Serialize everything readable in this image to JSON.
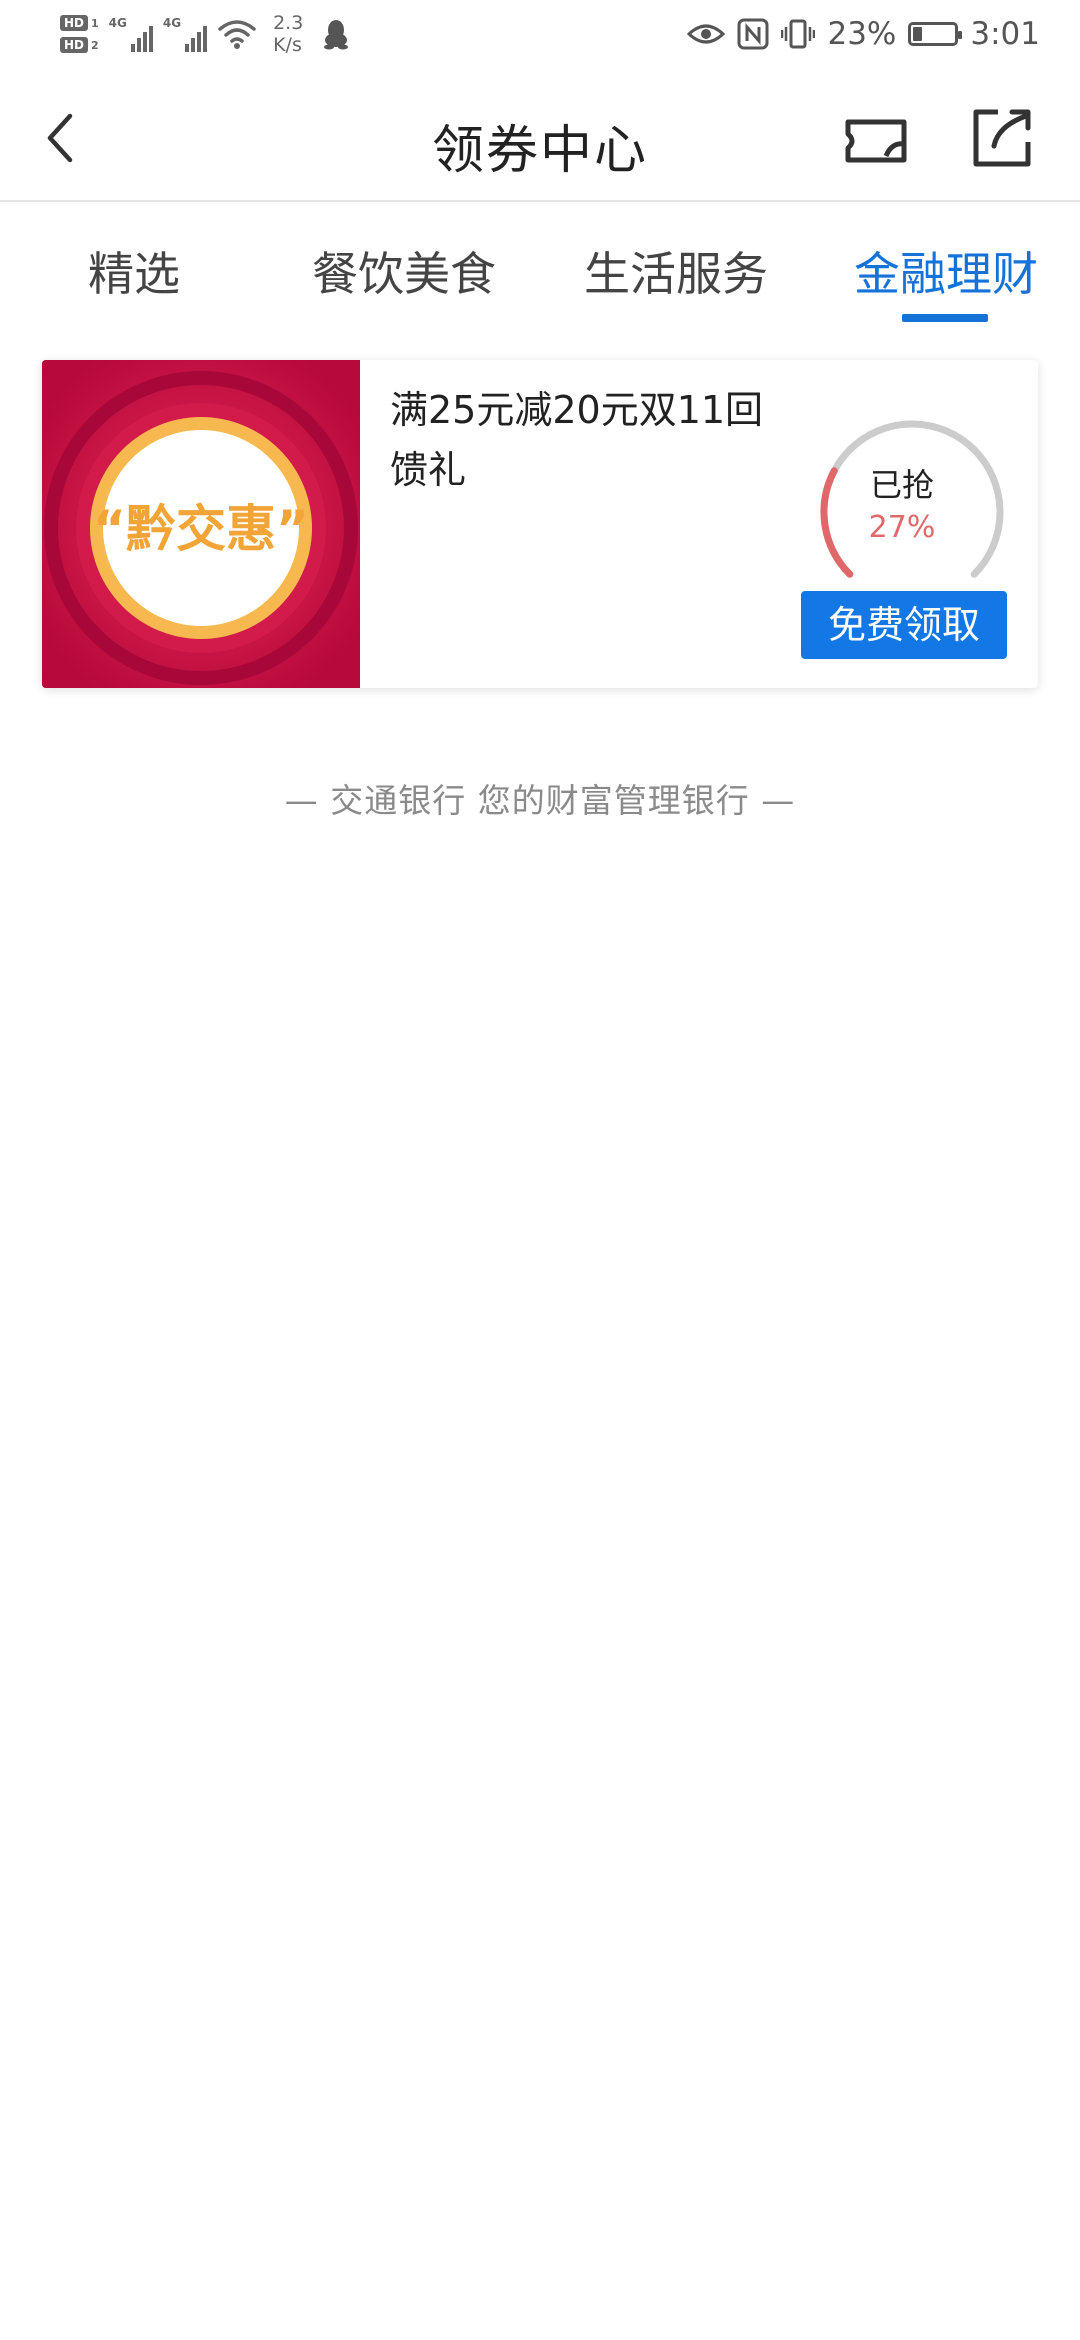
{
  "status_bar": {
    "hd_1": "HD",
    "hd_1_sub": "1",
    "hd_2": "HD",
    "hd_2_sub": "2",
    "network_1": "4G",
    "network_2": "4G",
    "speed_value": "2.3",
    "speed_unit": "K/s",
    "battery_percent": "23%",
    "battery_level": 0.23,
    "time": "3:01",
    "icons": [
      "signal-icon",
      "wifi-icon",
      "qq-penguin-icon",
      "eye-icon",
      "nfc-icon",
      "vibrate-icon",
      "battery-icon"
    ]
  },
  "header": {
    "title": "领券中心",
    "back_icon": "chevron-left-icon",
    "ticket_icon": "ticket-icon",
    "share_icon": "share-icon"
  },
  "tabs": [
    {
      "label": "精选",
      "active": false
    },
    {
      "label": "餐饮美食",
      "active": false
    },
    {
      "label": "生活服务",
      "active": false
    },
    {
      "label": "金融理财",
      "active": true
    }
  ],
  "coupon": {
    "image_text": "“黔交惠”",
    "title": "满25元减20元双11回馈礼",
    "claimed_label": "已抢",
    "claimed_percent": "27%",
    "claimed_fraction": 0.27,
    "button_label": "免费领取"
  },
  "footer": {
    "slogan": "—  交通银行 您的财富管理银行  —"
  },
  "colors": {
    "accent": "#1572d9",
    "button": "#1378e5",
    "progress": "#e0686a",
    "track": "#cccccc",
    "coupon_bg": "#c50f44"
  }
}
